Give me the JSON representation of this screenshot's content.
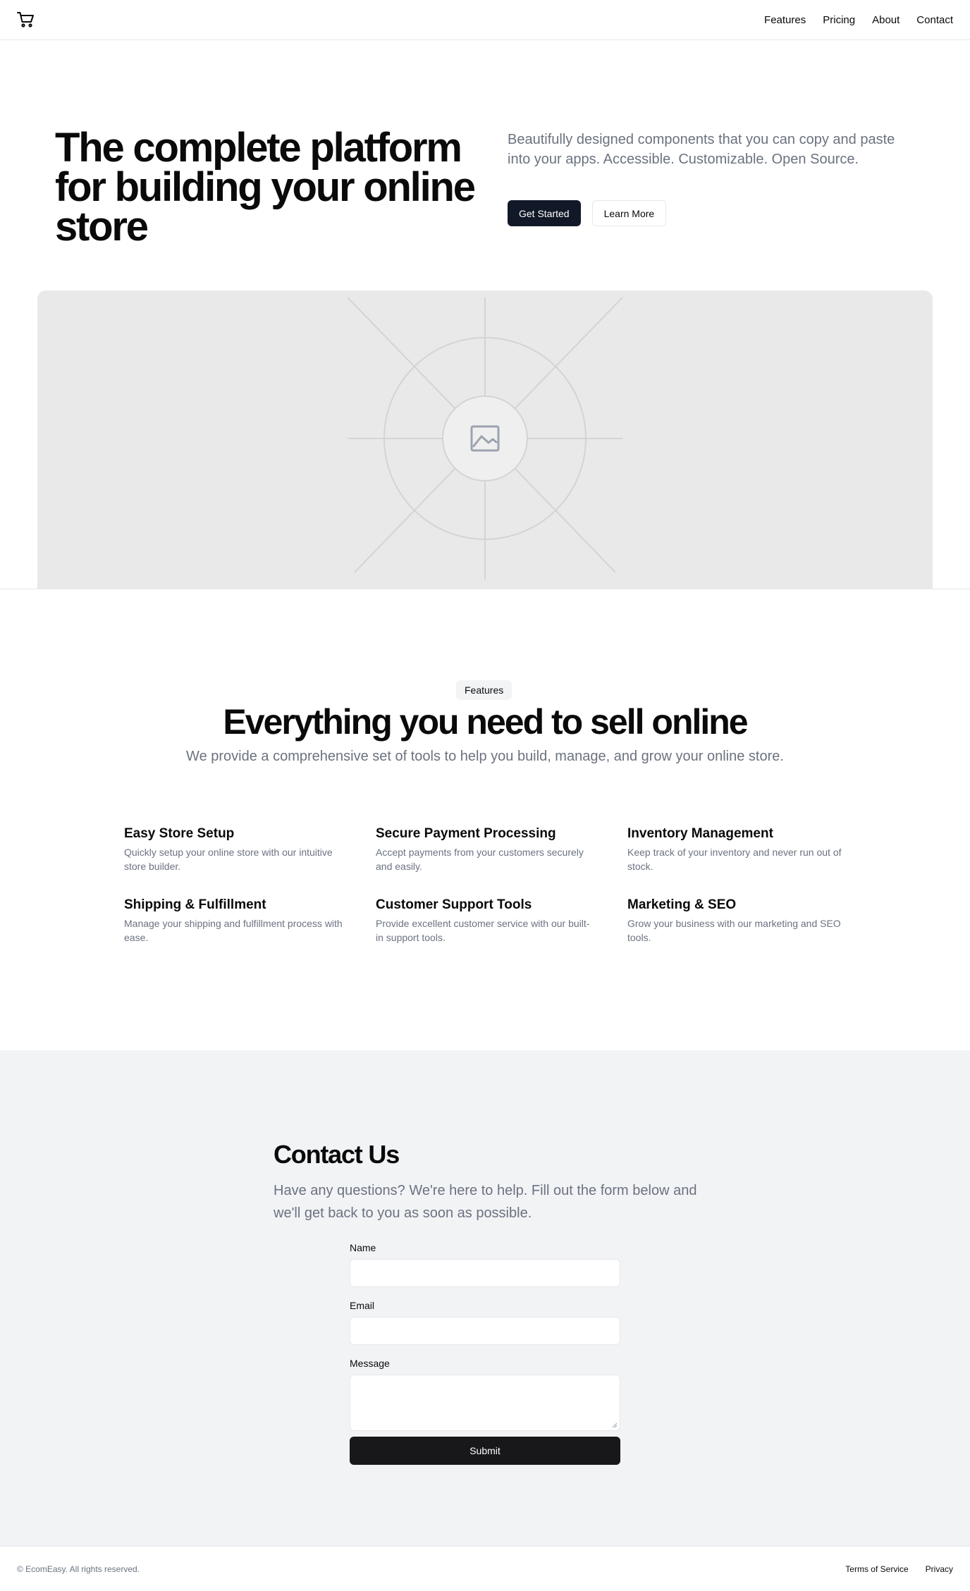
{
  "header": {
    "logo_icon": "shopping-cart-icon",
    "nav": [
      {
        "label": "Features"
      },
      {
        "label": "Pricing"
      },
      {
        "label": "About"
      },
      {
        "label": "Contact"
      }
    ]
  },
  "hero": {
    "title": "The complete platform for building your online store",
    "subtitle": "Beautifully designed components that you can copy and paste into your apps. Accessible. Customizable. Open Source.",
    "primary_button": "Get Started",
    "secondary_button": "Learn More",
    "image_icon": "image-placeholder-icon"
  },
  "features": {
    "badge": "Features",
    "title": "Everything you need to sell online",
    "subtitle": "We provide a comprehensive set of tools to help you build, manage, and grow your online store.",
    "items": [
      {
        "title": "Easy Store Setup",
        "description": "Quickly setup your online store with our intuitive store builder."
      },
      {
        "title": "Secure Payment Processing",
        "description": "Accept payments from your customers securely and easily."
      },
      {
        "title": "Inventory Management",
        "description": "Keep track of your inventory and never run out of stock."
      },
      {
        "title": "Shipping & Fulfillment",
        "description": "Manage your shipping and fulfillment process with ease."
      },
      {
        "title": "Customer Support Tools",
        "description": "Provide excellent customer service with our built-in support tools."
      },
      {
        "title": "Marketing & SEO",
        "description": "Grow your business with our marketing and SEO tools."
      }
    ]
  },
  "contact": {
    "title": "Contact Us",
    "subtitle": "Have any questions? We're here to help. Fill out the form below and we'll get back to you as soon as possible.",
    "name_label": "Name",
    "name_value": "",
    "email_label": "Email",
    "email_value": "",
    "message_label": "Message",
    "message_value": "",
    "submit_label": "Submit"
  },
  "footer": {
    "copyright": "© EcomEasy. All rights reserved.",
    "links": [
      {
        "label": "Terms of Service"
      },
      {
        "label": "Privacy"
      }
    ]
  },
  "colors": {
    "primary": "#111827",
    "muted_text": "#6b7280",
    "contact_bg": "#f2f3f5",
    "image_bg": "#e9e9e9"
  }
}
